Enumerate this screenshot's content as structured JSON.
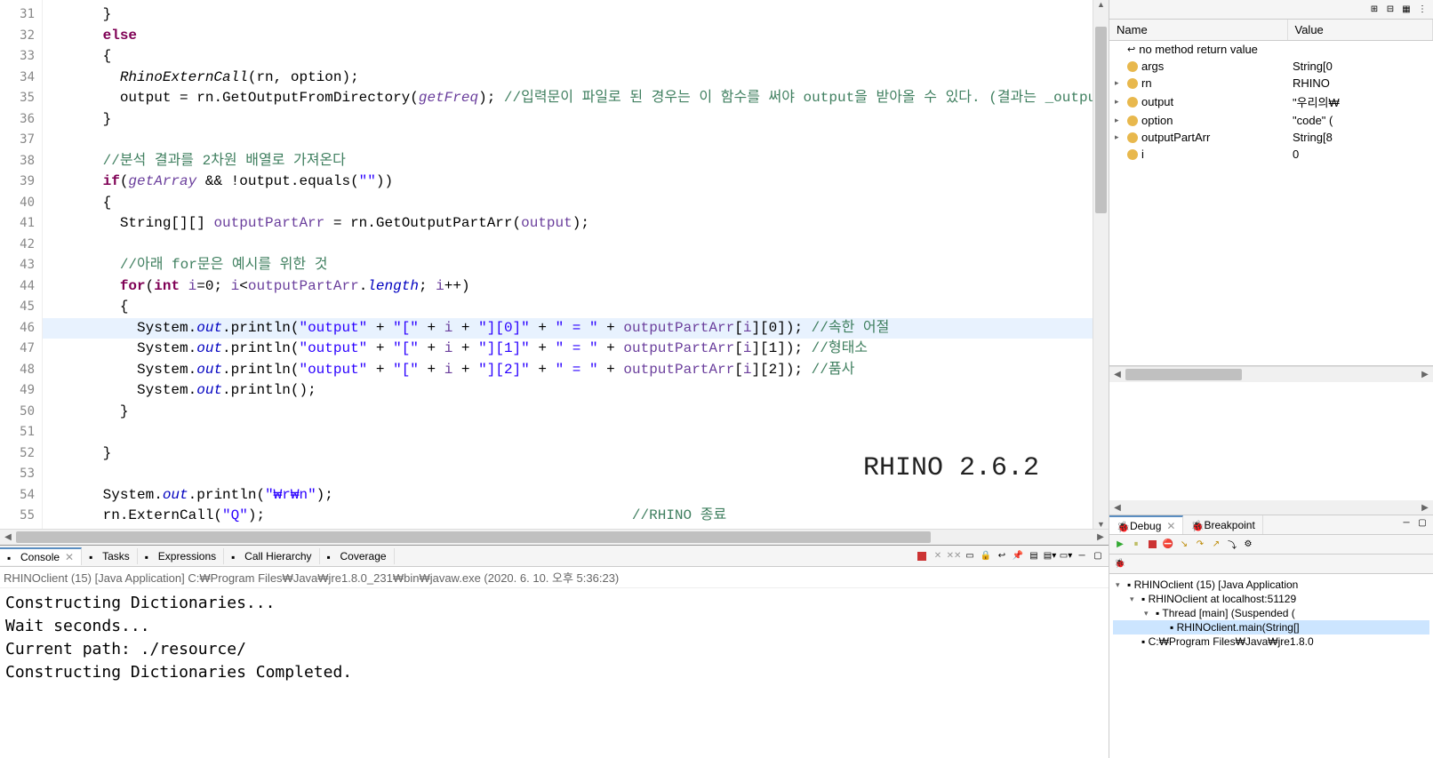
{
  "version_overlay": "RHINO 2.6.2",
  "gutter": {
    "start": 31,
    "end": 55
  },
  "code": {
    "lines": [
      {
        "n": 31,
        "indent": 3,
        "parts": [
          {
            "t": "}",
            "c": ""
          }
        ]
      },
      {
        "n": 32,
        "indent": 3,
        "parts": [
          {
            "t": "else",
            "c": "kw"
          }
        ]
      },
      {
        "n": 33,
        "indent": 3,
        "parts": [
          {
            "t": "{",
            "c": ""
          }
        ]
      },
      {
        "n": 34,
        "indent": 4,
        "parts": [
          {
            "t": "RhinoExternCall",
            "c": "method"
          },
          {
            "t": "(",
            "c": ""
          },
          {
            "t": "rn",
            "c": ""
          },
          {
            "t": ", ",
            "c": ""
          },
          {
            "t": "option",
            "c": ""
          },
          {
            "t": ");",
            "c": ""
          }
        ]
      },
      {
        "n": 35,
        "indent": 4,
        "parts": [
          {
            "t": "output",
            "c": ""
          },
          {
            "t": " = ",
            "c": ""
          },
          {
            "t": "rn",
            "c": ""
          },
          {
            "t": ".GetOutputFromDirectory(",
            "c": ""
          },
          {
            "t": "getFreq",
            "c": "param"
          },
          {
            "t": "); ",
            "c": ""
          },
          {
            "t": "//입력문이 파일로 된 경우는 이 함수를 써야 output을 받아올 수 있다. (결과는 _output 폴더에 기",
            "c": "comment"
          }
        ]
      },
      {
        "n": 36,
        "indent": 3,
        "parts": [
          {
            "t": "}",
            "c": ""
          }
        ]
      },
      {
        "n": 37,
        "indent": 3,
        "parts": []
      },
      {
        "n": 38,
        "indent": 3,
        "parts": [
          {
            "t": "//분석 결과를 2차원 배열로 가져온다",
            "c": "comment"
          }
        ]
      },
      {
        "n": 39,
        "indent": 3,
        "parts": [
          {
            "t": "if",
            "c": "kw"
          },
          {
            "t": "(",
            "c": ""
          },
          {
            "t": "getArray",
            "c": "param"
          },
          {
            "t": " && !",
            "c": ""
          },
          {
            "t": "output",
            "c": ""
          },
          {
            "t": ".equals(",
            "c": ""
          },
          {
            "t": "\"\"",
            "c": "str"
          },
          {
            "t": "))",
            "c": ""
          }
        ]
      },
      {
        "n": 40,
        "indent": 3,
        "parts": [
          {
            "t": "{",
            "c": ""
          }
        ]
      },
      {
        "n": 41,
        "indent": 4,
        "parts": [
          {
            "t": "String[][] ",
            "c": ""
          },
          {
            "t": "outputPartArr",
            "c": "varC"
          },
          {
            "t": " = ",
            "c": ""
          },
          {
            "t": "rn",
            "c": ""
          },
          {
            "t": ".GetOutputPartArr(",
            "c": ""
          },
          {
            "t": "output",
            "c": "varC"
          },
          {
            "t": ");",
            "c": ""
          }
        ]
      },
      {
        "n": 42,
        "indent": 4,
        "parts": []
      },
      {
        "n": 43,
        "indent": 4,
        "parts": [
          {
            "t": "//아래 for문은 예시를 위한 것",
            "c": "comment"
          }
        ]
      },
      {
        "n": 44,
        "indent": 4,
        "parts": [
          {
            "t": "for",
            "c": "kw"
          },
          {
            "t": "(",
            "c": ""
          },
          {
            "t": "int",
            "c": "kw"
          },
          {
            "t": " ",
            "c": ""
          },
          {
            "t": "i",
            "c": "varC"
          },
          {
            "t": "=0; ",
            "c": ""
          },
          {
            "t": "i",
            "c": "varC"
          },
          {
            "t": "<",
            "c": ""
          },
          {
            "t": "outputPartArr",
            "c": "varC"
          },
          {
            "t": ".",
            "c": ""
          },
          {
            "t": "length",
            "c": "field"
          },
          {
            "t": "; ",
            "c": ""
          },
          {
            "t": "i",
            "c": "varC"
          },
          {
            "t": "++)",
            "c": ""
          }
        ]
      },
      {
        "n": 45,
        "indent": 4,
        "parts": [
          {
            "t": "{",
            "c": ""
          }
        ]
      },
      {
        "n": 46,
        "indent": 5,
        "hl": true,
        "parts": [
          {
            "t": "System.",
            "c": ""
          },
          {
            "t": "out",
            "c": "field"
          },
          {
            "t": ".println(",
            "c": ""
          },
          {
            "t": "\"output\"",
            "c": "str"
          },
          {
            "t": " + ",
            "c": ""
          },
          {
            "t": "\"[\"",
            "c": "str"
          },
          {
            "t": " + ",
            "c": ""
          },
          {
            "t": "i",
            "c": "varC"
          },
          {
            "t": " + ",
            "c": ""
          },
          {
            "t": "\"][0]\"",
            "c": "str"
          },
          {
            "t": " + ",
            "c": ""
          },
          {
            "t": "\" = \"",
            "c": "str"
          },
          {
            "t": " + ",
            "c": ""
          },
          {
            "t": "outputPartArr",
            "c": "varC"
          },
          {
            "t": "[",
            "c": ""
          },
          {
            "t": "i",
            "c": "varC"
          },
          {
            "t": "][0]); ",
            "c": ""
          },
          {
            "t": "//속한 어절",
            "c": "comment"
          }
        ]
      },
      {
        "n": 47,
        "indent": 5,
        "parts": [
          {
            "t": "System.",
            "c": ""
          },
          {
            "t": "out",
            "c": "field"
          },
          {
            "t": ".println(",
            "c": ""
          },
          {
            "t": "\"output\"",
            "c": "str"
          },
          {
            "t": " + ",
            "c": ""
          },
          {
            "t": "\"[\"",
            "c": "str"
          },
          {
            "t": " + ",
            "c": ""
          },
          {
            "t": "i",
            "c": "varC"
          },
          {
            "t": " + ",
            "c": ""
          },
          {
            "t": "\"][1]\"",
            "c": "str"
          },
          {
            "t": " + ",
            "c": ""
          },
          {
            "t": "\" = \"",
            "c": "str"
          },
          {
            "t": " + ",
            "c": ""
          },
          {
            "t": "outputPartArr",
            "c": "varC"
          },
          {
            "t": "[",
            "c": ""
          },
          {
            "t": "i",
            "c": "varC"
          },
          {
            "t": "][1]); ",
            "c": ""
          },
          {
            "t": "//형태소",
            "c": "comment"
          }
        ]
      },
      {
        "n": 48,
        "indent": 5,
        "parts": [
          {
            "t": "System.",
            "c": ""
          },
          {
            "t": "out",
            "c": "field"
          },
          {
            "t": ".println(",
            "c": ""
          },
          {
            "t": "\"output\"",
            "c": "str"
          },
          {
            "t": " + ",
            "c": ""
          },
          {
            "t": "\"[\"",
            "c": "str"
          },
          {
            "t": " + ",
            "c": ""
          },
          {
            "t": "i",
            "c": "varC"
          },
          {
            "t": " + ",
            "c": ""
          },
          {
            "t": "\"][2]\"",
            "c": "str"
          },
          {
            "t": " + ",
            "c": ""
          },
          {
            "t": "\" = \"",
            "c": "str"
          },
          {
            "t": " + ",
            "c": ""
          },
          {
            "t": "outputPartArr",
            "c": "varC"
          },
          {
            "t": "[",
            "c": ""
          },
          {
            "t": "i",
            "c": "varC"
          },
          {
            "t": "][2]); ",
            "c": ""
          },
          {
            "t": "//품사",
            "c": "comment"
          }
        ]
      },
      {
        "n": 49,
        "indent": 5,
        "parts": [
          {
            "t": "System.",
            "c": ""
          },
          {
            "t": "out",
            "c": "field"
          },
          {
            "t": ".println();",
            "c": ""
          }
        ]
      },
      {
        "n": 50,
        "indent": 4,
        "parts": [
          {
            "t": "}",
            "c": ""
          }
        ]
      },
      {
        "n": 51,
        "indent": 4,
        "parts": []
      },
      {
        "n": 52,
        "indent": 3,
        "parts": [
          {
            "t": "}",
            "c": ""
          }
        ]
      },
      {
        "n": 53,
        "indent": 3,
        "parts": []
      },
      {
        "n": 54,
        "indent": 3,
        "parts": [
          {
            "t": "System.",
            "c": ""
          },
          {
            "t": "out",
            "c": "field"
          },
          {
            "t": ".println(",
            "c": ""
          },
          {
            "t": "\"₩r₩n\"",
            "c": "str"
          },
          {
            "t": ");",
            "c": ""
          }
        ]
      },
      {
        "n": 55,
        "indent": 3,
        "parts": [
          {
            "t": "rn",
            "c": ""
          },
          {
            "t": ".ExternCall(",
            "c": ""
          },
          {
            "t": "\"Q\"",
            "c": "str"
          },
          {
            "t": ");                                           ",
            "c": ""
          },
          {
            "t": "//RHINO 종료",
            "c": "comment"
          }
        ]
      }
    ]
  },
  "console": {
    "tabs": [
      {
        "label": "Console",
        "active": true,
        "closable": true
      },
      {
        "label": "Tasks"
      },
      {
        "label": "Expressions"
      },
      {
        "label": "Call Hierarchy"
      },
      {
        "label": "Coverage"
      }
    ],
    "header": "RHINOclient (15) [Java Application] C:₩Program Files₩Java₩jre1.8.0_231₩bin₩javaw.exe (2020. 6. 10. 오후 5:36:23)",
    "output": [
      "Constructing Dictionaries...",
      "Wait seconds...",
      "Current path: ./resource/",
      "Constructing Dictionaries Completed."
    ]
  },
  "variables": {
    "cols": {
      "name": "Name",
      "value": "Value"
    },
    "rows": [
      {
        "expand": "",
        "icon": "ret",
        "name": "no method return value",
        "value": ""
      },
      {
        "expand": "",
        "icon": "loc",
        "name": "args",
        "value": "String[0"
      },
      {
        "expand": ">",
        "icon": "loc",
        "name": "rn",
        "value": "RHINO"
      },
      {
        "expand": ">",
        "icon": "loc",
        "name": "output",
        "value": "\"우리의₩"
      },
      {
        "expand": ">",
        "icon": "loc",
        "name": "option",
        "value": "\"code\" ("
      },
      {
        "expand": ">",
        "icon": "loc",
        "name": "outputPartArr",
        "value": "String[8"
      },
      {
        "expand": "",
        "icon": "loc",
        "name": "i",
        "value": "0"
      }
    ]
  },
  "debug": {
    "tabs": [
      {
        "label": "Debug",
        "active": true,
        "closable": true
      },
      {
        "label": "Breakpoint"
      }
    ],
    "tree": [
      {
        "depth": 0,
        "exp": "v",
        "label": "RHINOclient (15) [Java Application"
      },
      {
        "depth": 1,
        "exp": "v",
        "label": "RHINOclient at localhost:51129"
      },
      {
        "depth": 2,
        "exp": "v",
        "label": "Thread [main] (Suspended ("
      },
      {
        "depth": 3,
        "exp": "",
        "label": "RHINOclient.main(String[]",
        "selected": true
      },
      {
        "depth": 1,
        "exp": "",
        "label": "C:₩Program Files₩Java₩jre1.8.0"
      }
    ]
  }
}
